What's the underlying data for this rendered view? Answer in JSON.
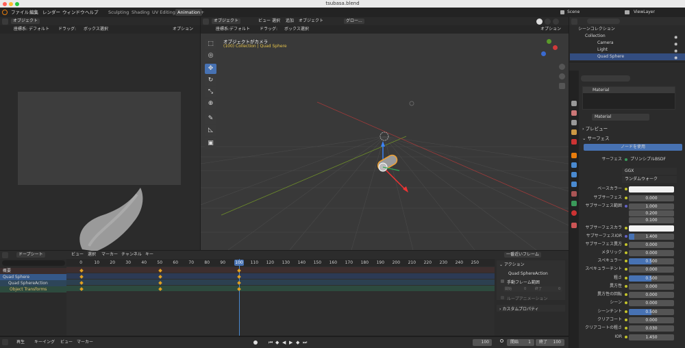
{
  "window": {
    "title": "tsubasa.blend"
  },
  "menu": [
    "ファイル",
    "編集",
    "レンダー",
    "ウィンドウ",
    "ヘルプ"
  ],
  "workspaces": [
    {
      "label": "Sculpting"
    },
    {
      "label": "Shading"
    },
    {
      "label": "UV Editing"
    },
    {
      "label": "Animation"
    }
  ],
  "scene": {
    "name": "Scene",
    "view_layer": "ViewLayer"
  },
  "left_viewport": {
    "mode": "オブジェクト",
    "header2": {
      "coord_label": "座標系:",
      "coord": "デフォルト",
      "drag_label": "ドラッグ:",
      "drag": "ボックス選択",
      "options": "オプション"
    }
  },
  "viewport": {
    "mode": "オブジェクト",
    "menus": [
      "ビュー",
      "選択",
      "追加",
      "オブジェクト"
    ],
    "orientation": "グロー...",
    "header2": {
      "coord_label": "座標系:",
      "coord": "デフォルト",
      "drag_label": "ドラッグ:",
      "drag": "ボックス選択",
      "options": "オプション"
    },
    "view_name": "オブジェクトがカメラ",
    "collection_line": "(100) Collection | Quad Sphere"
  },
  "outliner": {
    "title": "シーンコレクション",
    "items": [
      {
        "label": "Collection"
      },
      {
        "label": "Camera"
      },
      {
        "label": "Light"
      },
      {
        "label": "Quad Sphere"
      }
    ]
  },
  "properties": {
    "material_slot": "Material",
    "material_name": "Material",
    "sections": {
      "preview": "プレビュー",
      "surface": "サーフェス"
    },
    "use_nodes": "ノードを使用",
    "surface_row": {
      "label": "サーフェス",
      "value": "プリンシプルBSDF"
    },
    "ggx": "GGX",
    "random_walk": "ランダムウォーク",
    "rows": [
      {
        "label": "ベースカラー",
        "value": ""
      },
      {
        "label": "サブサーフェス",
        "value": "0.000"
      },
      {
        "label": "サブサーフェス範囲",
        "value": "1.000"
      },
      {
        "label": "",
        "value": "0.200"
      },
      {
        "label": "",
        "value": "0.100"
      },
      {
        "label": "サブサーフェスカラ",
        "value": ""
      },
      {
        "label": "サブサーフェスIOR",
        "value": "1.400"
      },
      {
        "label": "サブサーフェス異方",
        "value": "0.000"
      },
      {
        "label": "メタリック",
        "value": "0.000"
      },
      {
        "label": "スペキュラー",
        "value": "0.500"
      },
      {
        "label": "スペキュラーチント",
        "value": "0.000"
      },
      {
        "label": "粗さ",
        "value": "0.500"
      },
      {
        "label": "異方性",
        "value": "0.000"
      },
      {
        "label": "異方性の回転",
        "value": "0.000"
      },
      {
        "label": "シーン",
        "value": "0.000"
      },
      {
        "label": "シーンチント",
        "value": "0.500"
      },
      {
        "label": "クリアコート",
        "value": "0.000"
      },
      {
        "label": "クリアコートの粗さ",
        "value": "0.030"
      },
      {
        "label": "IOR",
        "value": "1.450"
      }
    ]
  },
  "dopesheet": {
    "mode": "ドープシート",
    "menus": [
      "ビュー",
      "選択",
      "マーカー",
      "チャンネル",
      "キー"
    ],
    "frame_mode": "一番近いフレーム",
    "ruler": [
      "0",
      "10",
      "20",
      "30",
      "40",
      "50",
      "60",
      "70",
      "80",
      "90",
      "100",
      "110",
      "120",
      "130",
      "140",
      "150",
      "160",
      "170",
      "180",
      "190",
      "200",
      "210",
      "220",
      "230",
      "240",
      "250"
    ],
    "current_frame": "100",
    "channels": [
      {
        "label": "概要"
      },
      {
        "label": "Quad Sphere"
      },
      {
        "label": "Quad SphereAction"
      },
      {
        "label": "Object Transforms"
      }
    ],
    "side": {
      "action_title": "アクション",
      "action_name": "Quad SphereAction",
      "manual_range": "手動フレーム範囲",
      "start_label": "開始",
      "start_val": "0",
      "end_label": "終了",
      "end_val": "0",
      "loop": "ループアニメーション",
      "custom": "カスタムプロパティ"
    }
  },
  "timeline": {
    "menus": [
      "再生",
      "キーイング",
      "ビュー",
      "マーカー"
    ],
    "frame": "100",
    "start_label": "開始",
    "start": "1",
    "end_label": "終了",
    "end": "100"
  }
}
